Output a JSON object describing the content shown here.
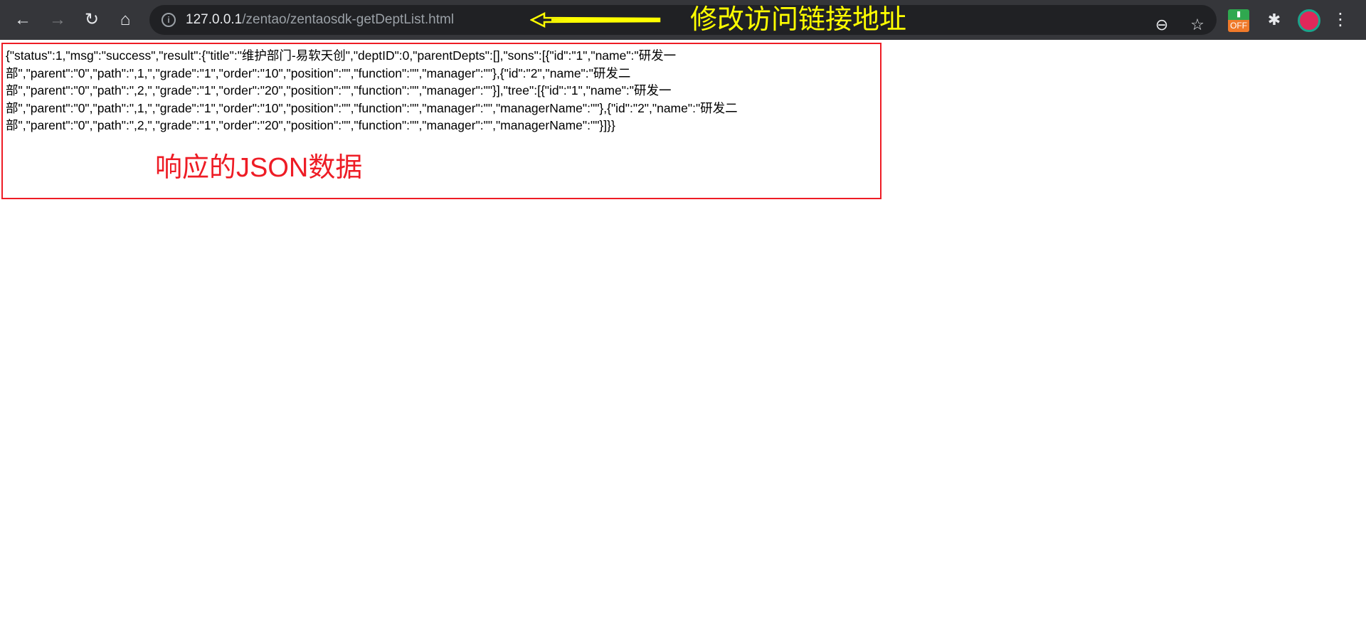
{
  "browser": {
    "url_host": "127.0.0.1",
    "url_path": "/zentao/zentaosdk-getDeptList.html",
    "ext_badge": "OFF"
  },
  "annotations": {
    "url_note": "修改访问链接地址",
    "response_note": "响应的JSON数据",
    "colors": {
      "yellow": "#ffff00",
      "red": "#ee1c25"
    }
  },
  "response_lines": [
    "{\"status\":1,\"msg\":\"success\",\"result\":{\"title\":\"维护部门-易软天创\",\"deptID\":0,\"parentDepts\":[],\"sons\":[{\"id\":\"1\",\"name\":\"研发一",
    "部\",\"parent\":\"0\",\"path\":\",1,\",\"grade\":\"1\",\"order\":\"10\",\"position\":\"\",\"function\":\"\",\"manager\":\"\"},{\"id\":\"2\",\"name\":\"研发二",
    "部\",\"parent\":\"0\",\"path\":\",2,\",\"grade\":\"1\",\"order\":\"20\",\"position\":\"\",\"function\":\"\",\"manager\":\"\"}],\"tree\":[{\"id\":\"1\",\"name\":\"研发一",
    "部\",\"parent\":\"0\",\"path\":\",1,\",\"grade\":\"1\",\"order\":\"10\",\"position\":\"\",\"function\":\"\",\"manager\":\"\",\"managerName\":\"\"},{\"id\":\"2\",\"name\":\"研发二",
    "部\",\"parent\":\"0\",\"path\":\",2,\",\"grade\":\"1\",\"order\":\"20\",\"position\":\"\",\"function\":\"\",\"manager\":\"\",\"managerName\":\"\"}]}}"
  ]
}
